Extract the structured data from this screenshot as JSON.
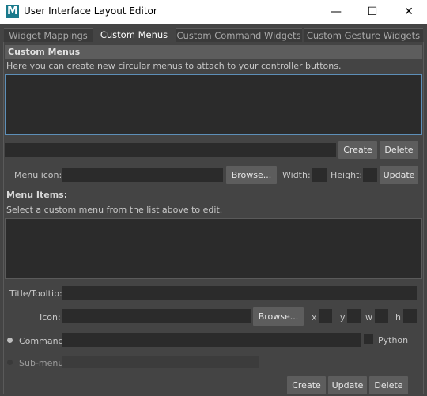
{
  "window": {
    "app_icon_letter": "M",
    "title": "User Interface Layout Editor",
    "minimize": "—",
    "maximize": "☐",
    "close": "✕"
  },
  "tabs": [
    {
      "label": "Widget Mappings"
    },
    {
      "label": "Custom Menus"
    },
    {
      "label": "Custom Command Widgets"
    },
    {
      "label": "Custom Gesture Widgets"
    }
  ],
  "custom_menus": {
    "header": "Custom Menus",
    "description": "Here you can create new circular menus to attach to your controller buttons.",
    "create_label": "Create",
    "delete_label": "Delete",
    "menu_icon_label": "Menu icon:",
    "browse_label": "Browse...",
    "width_label": "Width:",
    "height_label": "Height:",
    "update_label": "Update"
  },
  "menu_items": {
    "header": "Menu Items:",
    "hint": "Select a custom menu from the list above to edit.",
    "title_tooltip_label": "Title/Tooltip:",
    "icon_label": "Icon:",
    "browse_label": "Browse...",
    "x_label": "x",
    "y_label": "y",
    "w_label": "w",
    "h_label": "h",
    "command_label": "Command",
    "python_label": "Python",
    "submenu_label": "Sub-menu",
    "create_label": "Create",
    "update_label": "Update",
    "delete_label": "Delete"
  }
}
